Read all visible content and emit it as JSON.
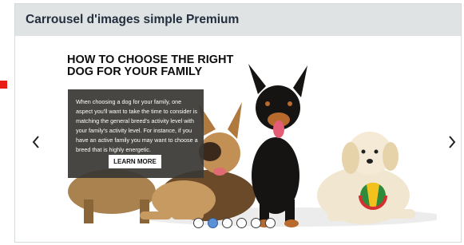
{
  "header": {
    "title": "Carrousel d'images simple Premium"
  },
  "carousel": {
    "prev_icon": "chevron-left-icon",
    "next_icon": "chevron-right-icon",
    "slide": {
      "headline_line1": "HOW TO CHOOSE THE RIGHT",
      "headline_line2": "DOG FOR YOUR FAMILY",
      "body": "When choosing a dog for your family, one aspect you'll want to take the time to consider is matching the general breed's activity level with your family's activity level. For instance, if you have an active family you may want to choose a breed that is highly energetic.",
      "button_label": "LEARN MORE"
    },
    "slide_count": 6,
    "active_index": 1,
    "dot_states": [
      "inactive",
      "active",
      "inactive",
      "inactive",
      "inactive",
      "inactive"
    ]
  },
  "colors": {
    "header_bg": "#dfe3e3",
    "title_text": "#232f3e",
    "overlay_bg": "#3a3834",
    "active_dot": "#5b8fd6",
    "marker": "#e81c14"
  }
}
